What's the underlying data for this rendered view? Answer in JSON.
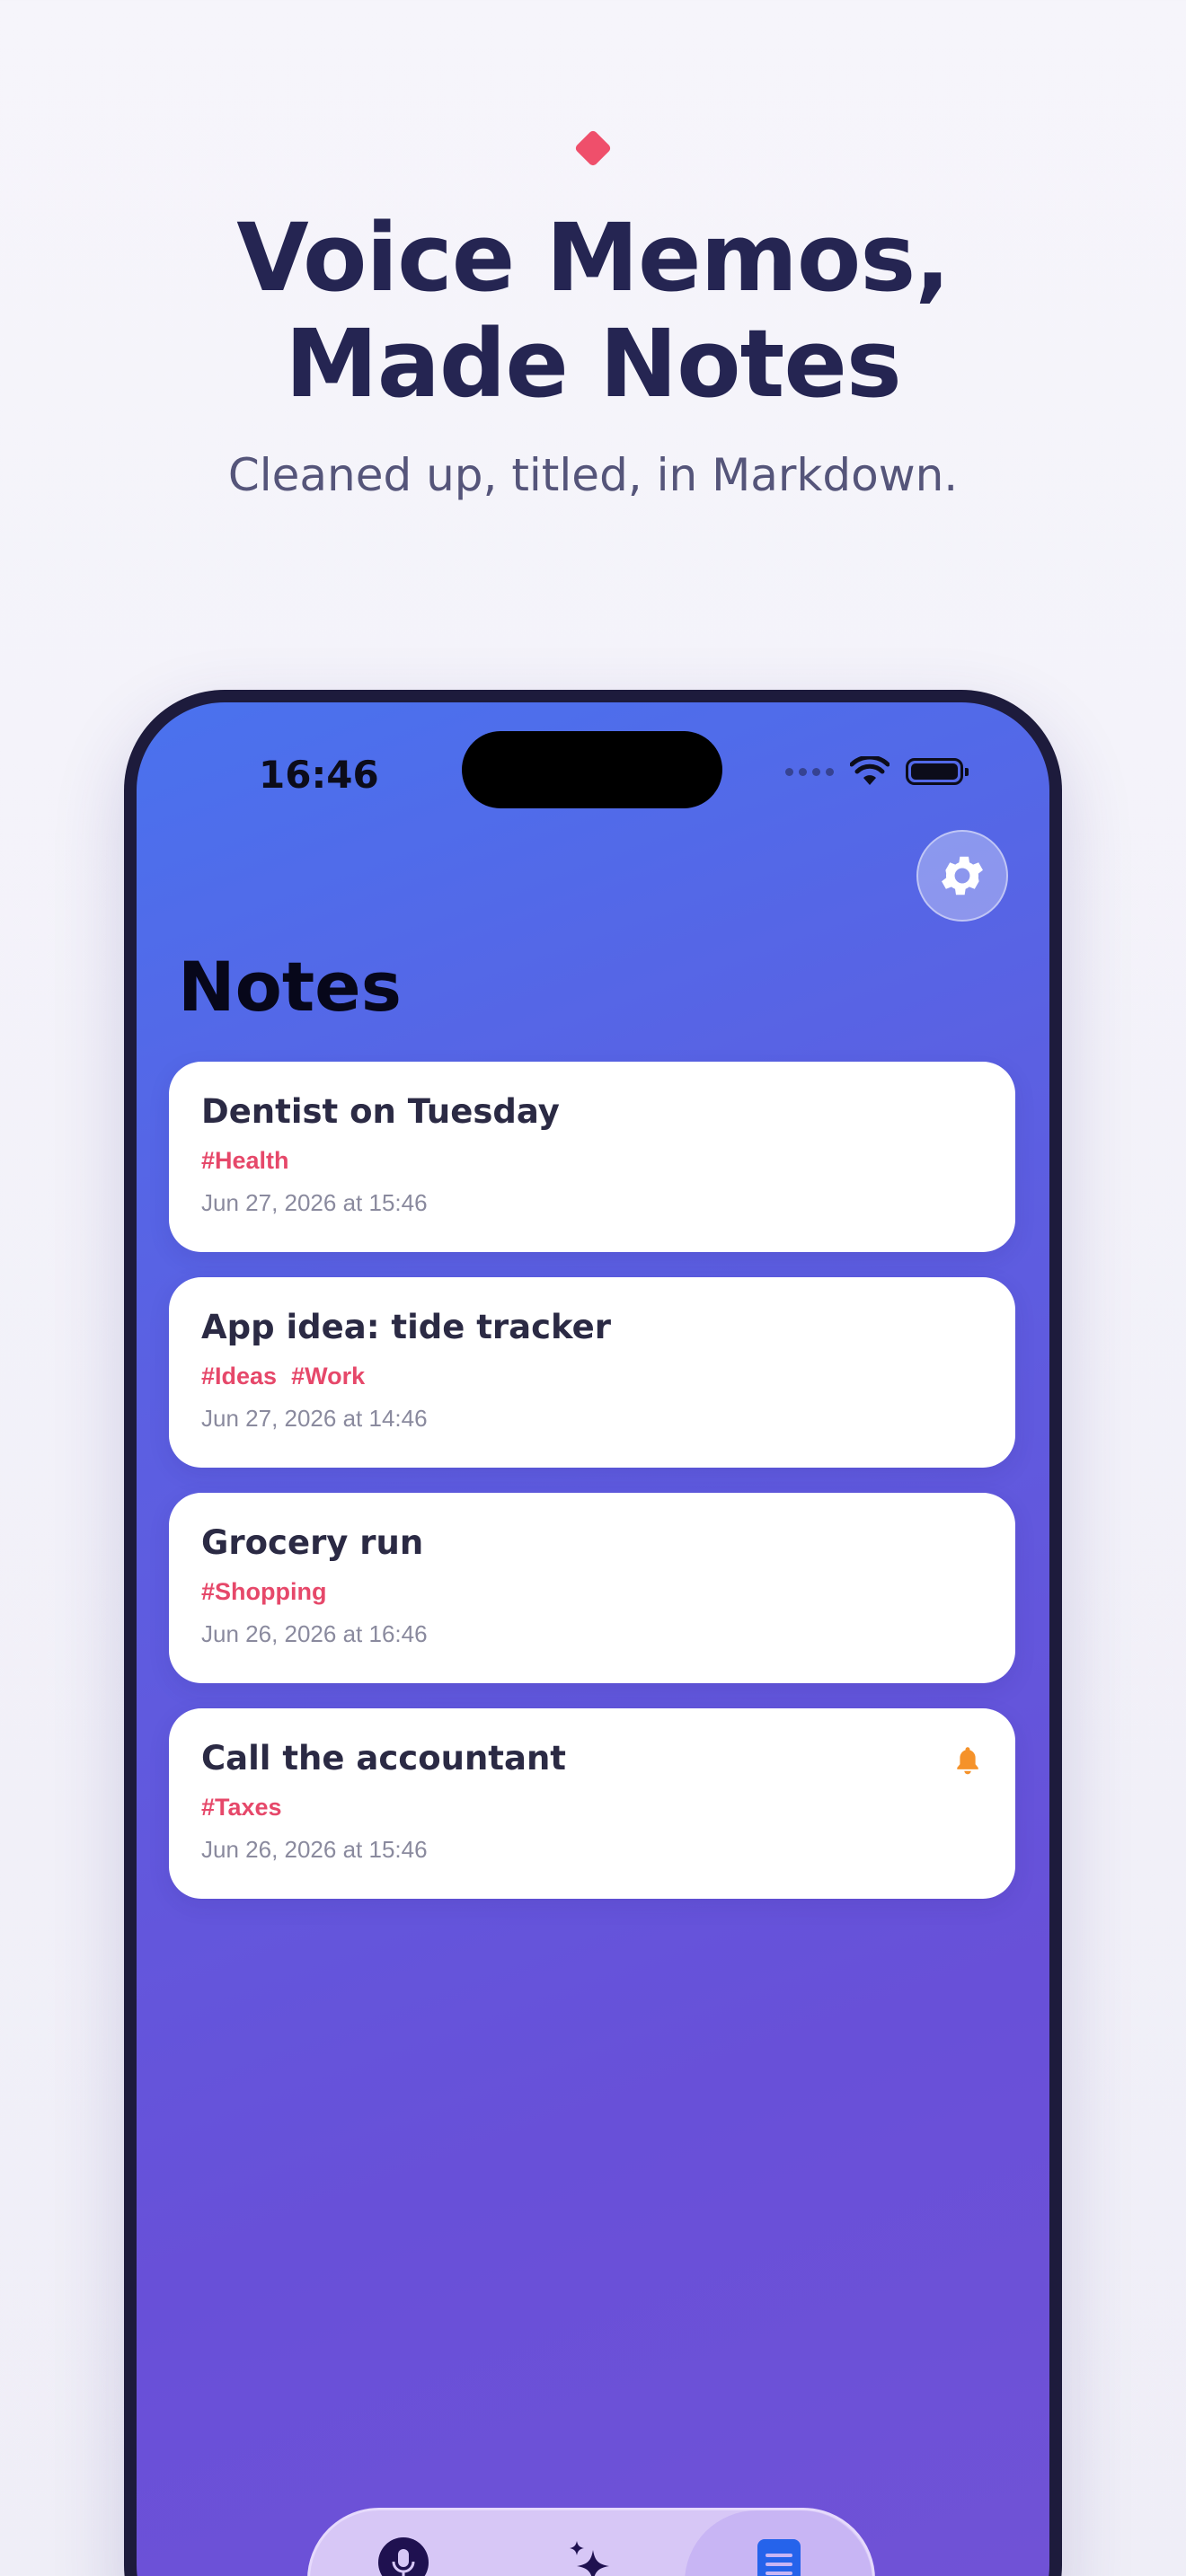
{
  "hero": {
    "headline_line1": "Voice Memos,",
    "headline_line2": "Made Notes",
    "subtitle": "Cleaned up, titled, in Markdown."
  },
  "status_bar": {
    "time": "16:46"
  },
  "page": {
    "title": "Notes"
  },
  "notes": [
    {
      "title": "Dentist on Tuesday",
      "tags": [
        "#Health"
      ],
      "date": "Jun 27, 2026 at 15:46",
      "reminder": false
    },
    {
      "title": "App idea: tide tracker",
      "tags": [
        "#Ideas",
        "#Work"
      ],
      "date": "Jun 27, 2026 at 14:46",
      "reminder": false
    },
    {
      "title": "Grocery run",
      "tags": [
        "#Shopping"
      ],
      "date": "Jun 26, 2026 at 16:46",
      "reminder": false
    },
    {
      "title": "Call the accountant",
      "tags": [
        "#Taxes"
      ],
      "date": "Jun 26, 2026 at 15:46",
      "reminder": true
    }
  ],
  "tabs": [
    {
      "icon": "microphone-icon",
      "active": false
    },
    {
      "icon": "sparkles-icon",
      "active": false
    },
    {
      "icon": "document-icon",
      "active": true
    }
  ],
  "colors": {
    "accent_tag": "#e6486a",
    "reminder_bell": "#f5922a",
    "headline": "#252552",
    "screen_gradient_start": "#4a72ee",
    "screen_gradient_end": "#7152d6"
  }
}
